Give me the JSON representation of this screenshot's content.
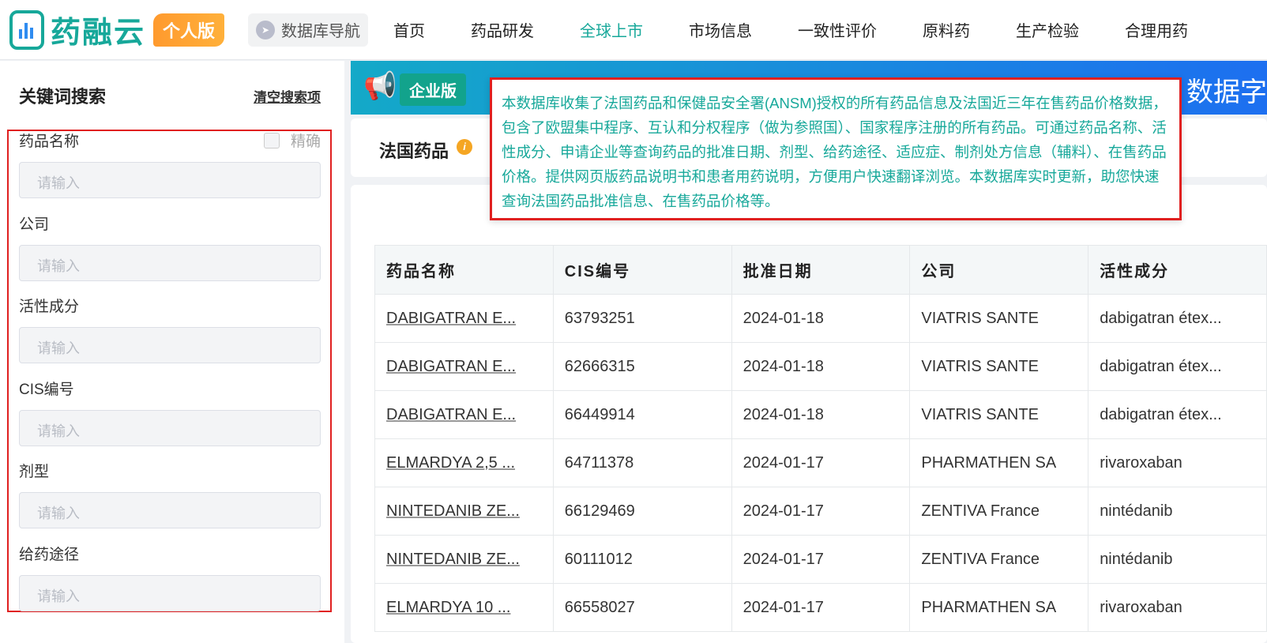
{
  "header": {
    "logo": "药融云",
    "edition": "个人版",
    "db_nav": "数据库导航",
    "menu": [
      "首页",
      "药品研发",
      "全球上市",
      "市场信息",
      "一致性评价",
      "原料药",
      "生产检验",
      "合理用药"
    ],
    "active": "全球上市"
  },
  "sidebar": {
    "title": "关键词搜索",
    "clear": "清空搜索项",
    "exact": "精确",
    "fields": [
      {
        "label": "药品名称",
        "placeholder": "请输入"
      },
      {
        "label": "公司",
        "placeholder": "请输入"
      },
      {
        "label": "活性成分",
        "placeholder": "请输入"
      },
      {
        "label": "CIS编号",
        "placeholder": "请输入"
      },
      {
        "label": "剂型",
        "placeholder": "请输入"
      },
      {
        "label": "给药途径",
        "placeholder": "请输入"
      }
    ]
  },
  "banner": {
    "badge": "企业版",
    "text_visible": "数据字"
  },
  "card": {
    "title": "法国药品",
    "info": "i"
  },
  "tooltip": "本数据库收集了法国药品和保健品安全署(ANSM)授权的所有药品信息及法国近三年在售药品价格数据，包含了欧盟集中程序、互认和分权程序（做为参照国）、国家程序注册的所有药品。可通过药品名称、活性成分、申请企业等查询药品的批准日期、剂型、给药途径、适应症、制剂处方信息（辅料）、在售药品价格。提供网页版药品说明书和患者用药说明，方便用户快速翻译浏览。本数据库实时更新，助您快速查询法国药品批准信息、在售药品价格等。",
  "table": {
    "headers": [
      "药品名称",
      "CIS编号",
      "批准日期",
      "公司",
      "活性成分"
    ],
    "rows": [
      [
        "DABIGATRAN E...",
        "63793251",
        "2024-01-18",
        "VIATRIS SANTE",
        "dabigatran étex..."
      ],
      [
        "DABIGATRAN E...",
        "62666315",
        "2024-01-18",
        "VIATRIS SANTE",
        "dabigatran étex..."
      ],
      [
        "DABIGATRAN E...",
        "66449914",
        "2024-01-18",
        "VIATRIS SANTE",
        "dabigatran étex..."
      ],
      [
        "ELMARDYA 2,5 ...",
        "64711378",
        "2024-01-17",
        "PHARMATHEN SA",
        "rivaroxaban"
      ],
      [
        "NINTEDANIB ZE...",
        "66129469",
        "2024-01-17",
        "ZENTIVA France",
        "nintédanib"
      ],
      [
        "NINTEDANIB ZE...",
        "60111012",
        "2024-01-17",
        "ZENTIVA France",
        "nintédanib"
      ],
      [
        "ELMARDYA 10 ...",
        "66558027",
        "2024-01-17",
        "PHARMATHEN SA",
        "rivaroxaban"
      ]
    ]
  }
}
